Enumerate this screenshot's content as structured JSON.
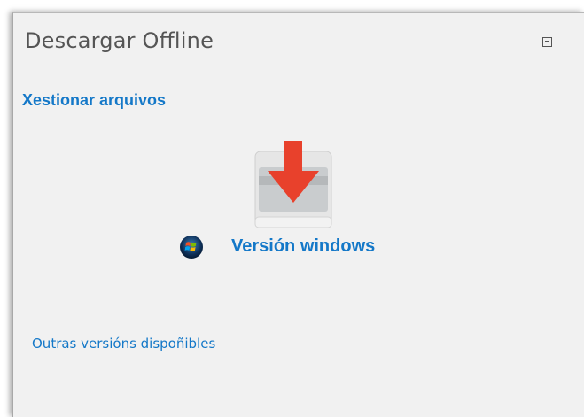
{
  "block": {
    "title": "Descargar Offline",
    "collapse_icon": "minus-square-icon",
    "manage_files_label": "Xestionar arquivos",
    "download_icon": "download-arrow-icon",
    "windows_icon": "windows-logo-icon",
    "windows_version_label": "Versión windows",
    "other_versions_label": "Outras versións dispoñibles"
  },
  "colors": {
    "panel_bg": "#f1f1f1",
    "title_text": "#555555",
    "link": "#1478c8",
    "download_arrow": "#e8412c",
    "tray": "#c9ccce"
  }
}
